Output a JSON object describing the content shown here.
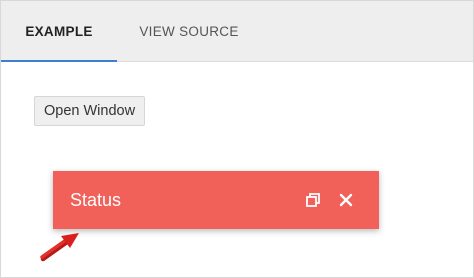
{
  "tabs": [
    {
      "label": "EXAMPLE",
      "active": true
    },
    {
      "label": "VIEW SOURCE",
      "active": false
    }
  ],
  "main": {
    "open_window_label": "Open Window"
  },
  "window": {
    "title": "Status",
    "restore_icon": "restore-icon",
    "close_icon": "close-icon",
    "color": "#f2605a"
  },
  "annotation": {
    "icon": "pointer-arrow",
    "color": "#d9201f"
  },
  "colors": {
    "tab_indicator": "#3f7fd0",
    "tabbar_bg": "#eeeeee"
  }
}
